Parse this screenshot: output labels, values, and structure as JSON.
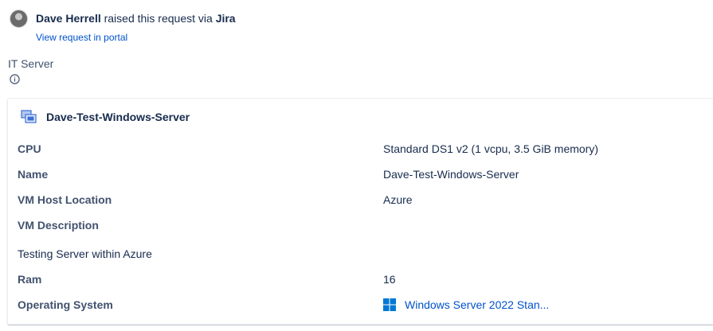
{
  "requester": {
    "name": "Dave Herrell",
    "action_text": "raised this request via",
    "channel": "Jira",
    "portal_link": "View request in portal"
  },
  "request_type": {
    "label": "IT Server",
    "info_icon": "info-icon"
  },
  "asset_card": {
    "icon": "virtual-machine-icon",
    "title": "Dave-Test-Windows-Server",
    "fields": [
      {
        "label": "CPU",
        "value": "Standard DS1 v2 (1 vcpu, 3.5 GiB memory)"
      },
      {
        "label": "Name",
        "value": "Dave-Test-Windows-Server"
      },
      {
        "label": "VM Host Location",
        "value": "Azure"
      },
      {
        "label": "VM Description",
        "value": "Testing Server within Azure"
      },
      {
        "label": "Ram",
        "value": "16"
      },
      {
        "label": "Operating System",
        "value": "Windows Server 2022 Stan...",
        "icon": "windows-logo-icon"
      }
    ]
  },
  "colors": {
    "link": "#0052cc",
    "text": "#172b4d",
    "label": "#42526e",
    "windows_blue": "#0078d4"
  }
}
